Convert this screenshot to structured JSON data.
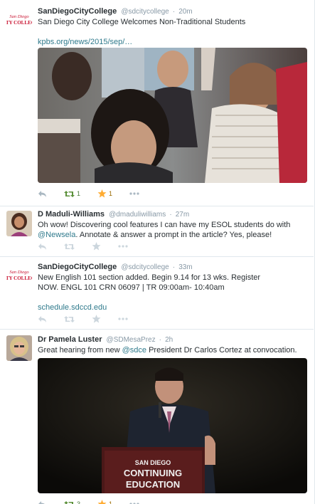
{
  "tweets": [
    {
      "fullname": "SanDiegoCityCollege",
      "username": "@sdcitycollege",
      "time": "20m",
      "text": "San Diego City College Welcomes Non-Traditional Students",
      "link": "kpbs.org/news/2015/sep/…",
      "retweets": "1",
      "favorites": "1",
      "retweet_color": "#5c913b",
      "favorite_color": "#ffac33"
    },
    {
      "fullname": "D Maduli-Williams",
      "username": "@dmaduliwilliams",
      "time": "27m",
      "text_part1": "Oh wow! Discovering cool features I can have my ESOL students do with ",
      "mention": "@Newsela",
      "text_part2": ". Annotate & answer a prompt in the article? Yes, please!"
    },
    {
      "fullname": "SanDiegoCityCollege",
      "username": "@sdcitycollege",
      "time": "33m",
      "text": "New English 101 section added. Begin 9.14  for 13 wks. Register NOW. ENGL 101 CRN 06097 | TR 09:00am- 10:40am",
      "link": "schedule.sdccd.edu"
    },
    {
      "fullname": "Dr Pamela Luster",
      "username": "@SDMesaPrez",
      "time": "2h",
      "text_part1": "Great hearing from new ",
      "mention": "@sdce",
      "text_part2": " President Dr Carlos Cortez at convocation.",
      "retweets": "3",
      "favorites": "1",
      "podium_line1": "SAN DIEGO",
      "podium_line2": "CONTINUING",
      "podium_line3": "EDUCATION"
    }
  ],
  "logo": {
    "line1": "SAN DIEGO",
    "line2": "CITY COLLEGE",
    "color": "#c8102e"
  },
  "accent": "#2f7a8c"
}
